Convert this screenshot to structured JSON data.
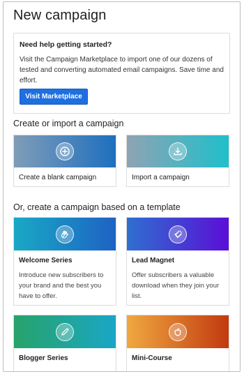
{
  "page": {
    "title": "New campaign"
  },
  "help": {
    "title": "Need help getting started?",
    "body": "Visit the Campaign Marketplace to import one of our dozens of tested and converting automated email campaigns. Save time and effort.",
    "button_label": "Visit Marketplace"
  },
  "create_section": {
    "title": "Create or import a campaign",
    "cards": [
      {
        "label": "Create a blank campaign",
        "icon": "plus-circle-icon"
      },
      {
        "label": "Import a campaign",
        "icon": "download-tray-icon"
      }
    ]
  },
  "template_section": {
    "title": "Or, create a campaign based on a template",
    "cards": [
      {
        "label": "Welcome Series",
        "description": "Introduce new subscribers to your brand and the best you have to offer.",
        "icon": "waving-hand-icon"
      },
      {
        "label": "Lead Magnet",
        "description": "Offer subscribers a valuable download when they join your list.",
        "icon": "magnet-icon"
      },
      {
        "label": "Blogger Series",
        "description": "",
        "icon": "pencil-icon"
      },
      {
        "label": "Mini-Course",
        "description": "",
        "icon": "apple-icon"
      }
    ]
  },
  "colors": {
    "accent": "#1e6fe0",
    "blank_banner": [
      "#7f9db8",
      "#1e6fbf"
    ],
    "import_banner": [
      "#8fa3b3",
      "#1fbfcb"
    ],
    "welcome_banner": [
      "#19a9c5",
      "#1e62c4"
    ],
    "lead_banner": [
      "#2f6fd0",
      "#5a0fd6"
    ],
    "blogger_banner": [
      "#27a36a",
      "#1aa6c6"
    ],
    "minicourse_banner": [
      "#f0a840",
      "#c23a10"
    ]
  }
}
